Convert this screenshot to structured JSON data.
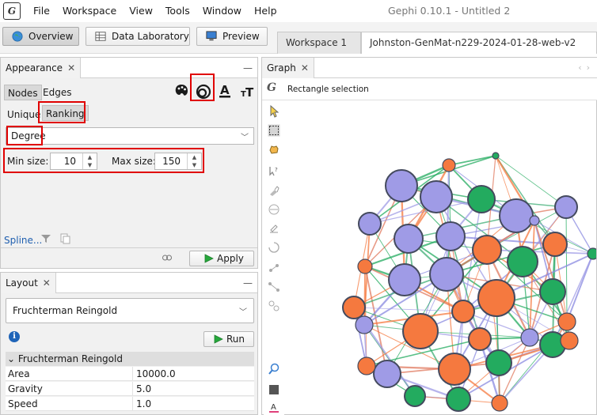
{
  "window": {
    "title": "Gephi 0.10.1 - Untitled 2",
    "menu": [
      "File",
      "Workspace",
      "View",
      "Tools",
      "Window",
      "Help"
    ]
  },
  "modes": {
    "overview": "Overview",
    "data_laboratory": "Data Laboratory",
    "preview": "Preview"
  },
  "workspaces": [
    "Workspace 1",
    "Johnston-GenMat-n229-2024-01-28-web-v2"
  ],
  "appearance": {
    "title": "Appearance",
    "tabs": [
      "Nodes",
      "Edges"
    ],
    "subtabs": [
      "Unique",
      "Ranking"
    ],
    "attribute": "Degree",
    "min_size_label": "Min size:",
    "min_size": "10",
    "max_size_label": "Max size:",
    "max_size": "150",
    "spline_label": "Spline...",
    "apply_label": "Apply",
    "highlight_color": "#e00000"
  },
  "layout": {
    "title": "Layout",
    "algorithm": "Fruchterman Reingold",
    "run_label": "Run",
    "section_title": "Fruchterman Reingold",
    "properties": [
      {
        "name": "Area",
        "value": "10000.0"
      },
      {
        "name": "Gravity",
        "value": "5.0"
      },
      {
        "name": "Speed",
        "value": "1.0"
      }
    ]
  },
  "graph": {
    "title": "Graph",
    "selection_mode": "Rectangle selection",
    "node_colors": {
      "purple": "#9f9be6",
      "orange": "#f5793f",
      "green": "#23ab5f"
    },
    "tool_icons": [
      "pointer-icon",
      "rectangle-selection-icon",
      "drag-hand-icon",
      "edge-pencil-icon",
      "painter-icon",
      "brush-icon",
      "resize-icon",
      "heatmap-icon",
      "shortest-path-icon",
      "node-pencil-icon",
      "edge-add-icon",
      "cluster-icon",
      "zoom-icon",
      "background-color-icon",
      "label-color-icon"
    ]
  }
}
